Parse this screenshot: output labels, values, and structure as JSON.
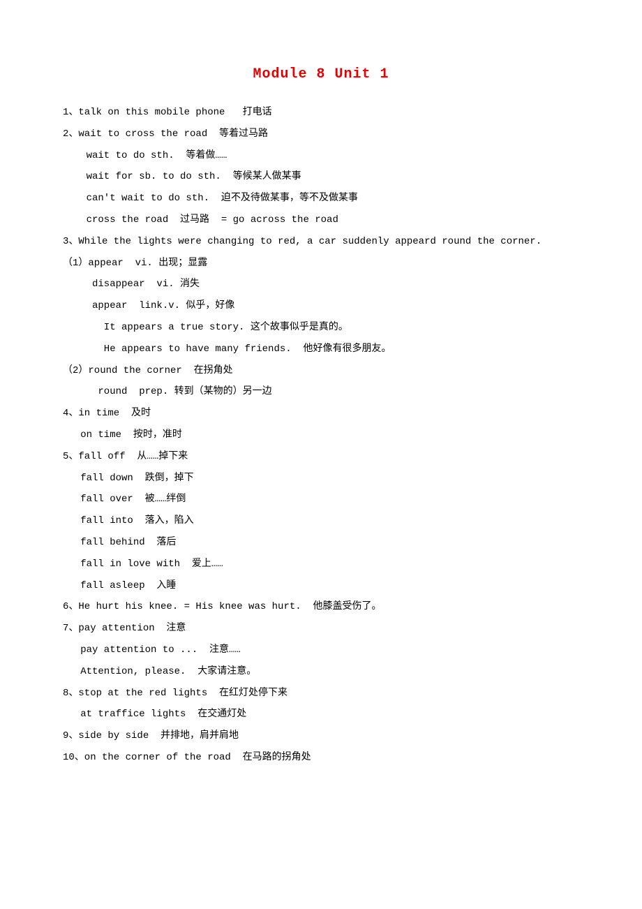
{
  "title": "Module 8  Unit 1",
  "lines": [
    "1、talk on this mobile phone   打电话",
    "2、wait to cross the road  等着过马路",
    "    wait to do sth.  等着做……",
    "    wait for sb. to do sth.  等候某人做某事",
    "    can't wait to do sth.  迫不及待做某事，等不及做某事",
    "    cross the road  过马路  = go across the road",
    "3、While the lights were changing to red, a car suddenly appeard round the corner.",
    "（1）appear  vi. 出现；显露",
    "     disappear  vi. 消失",
    "     appear  link.v. 似乎，好像",
    "       It appears a true story. 这个故事似乎是真的。",
    "       He appears to have many friends.  他好像有很多朋友。",
    "（2）round the corner  在拐角处",
    "      round  prep. 转到（某物的）另一边",
    "4、in time  及时",
    "   on time  按时，准时",
    "5、fall off  从……掉下来",
    "   fall down  跌倒，掉下",
    "   fall over  被……绊倒",
    "   fall into  落入，陷入",
    "   fall behind  落后",
    "   fall in love with  爱上……",
    "   fall asleep  入睡",
    "6、He hurt his knee. = His knee was hurt.  他膝盖受伤了。",
    "7、pay attention  注意",
    "   pay attention to ...  注意……",
    "   Attention, please.  大家请注意。",
    "8、stop at the red lights  在红灯处停下来",
    "   at traffice lights  在交通灯处",
    "9、side by side  并排地，肩并肩地",
    "10、on the corner of the road  在马路的拐角处"
  ]
}
